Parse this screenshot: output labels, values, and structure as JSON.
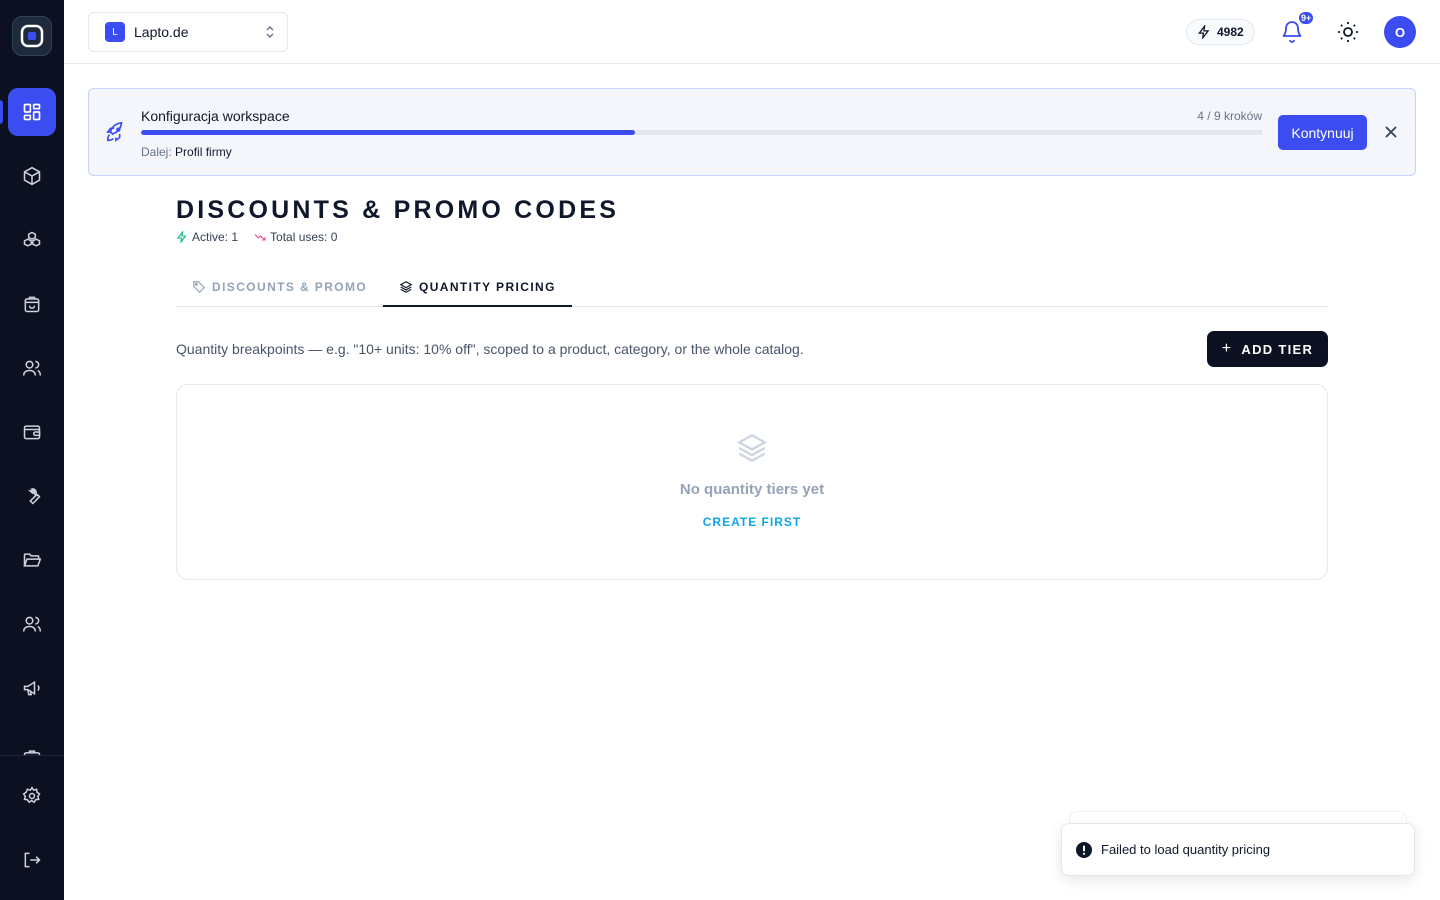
{
  "topbar": {
    "workspace_initial": "L",
    "workspace_name": "Lapto.de",
    "credits": "4982",
    "notifications_badge": "9+",
    "avatar_initial": "O"
  },
  "banner": {
    "title": "Konfiguracja workspace",
    "steps": "4 / 9 kroków",
    "progress": 0.44,
    "next_label": "Dalej:",
    "next_value": "Profil firmy",
    "continue_label": "Kontynuuj"
  },
  "page": {
    "title": "DISCOUNTS & PROMO CODES",
    "active_stat": "Active: 1",
    "uses_stat": "Total uses: 0"
  },
  "tabs": [
    {
      "label": "DISCOUNTS & PROMO",
      "icon": "tag-icon"
    },
    {
      "label": "QUANTITY PRICING",
      "icon": "layers-icon"
    }
  ],
  "content": {
    "description": "Quantity breakpoints — e.g. \"10+ units: 10% off\", scoped to a product, category, or the whole catalog.",
    "add_button": "ADD TIER",
    "empty_title": "No quantity tiers yet",
    "empty_link": "CREATE FIRST"
  },
  "toast": {
    "message": "Failed to load quantity pricing"
  },
  "colors": {
    "accent": "#3b4cf0",
    "sidebar": "#0b1120",
    "link": "#0ea5e9",
    "success": "#10b981"
  }
}
